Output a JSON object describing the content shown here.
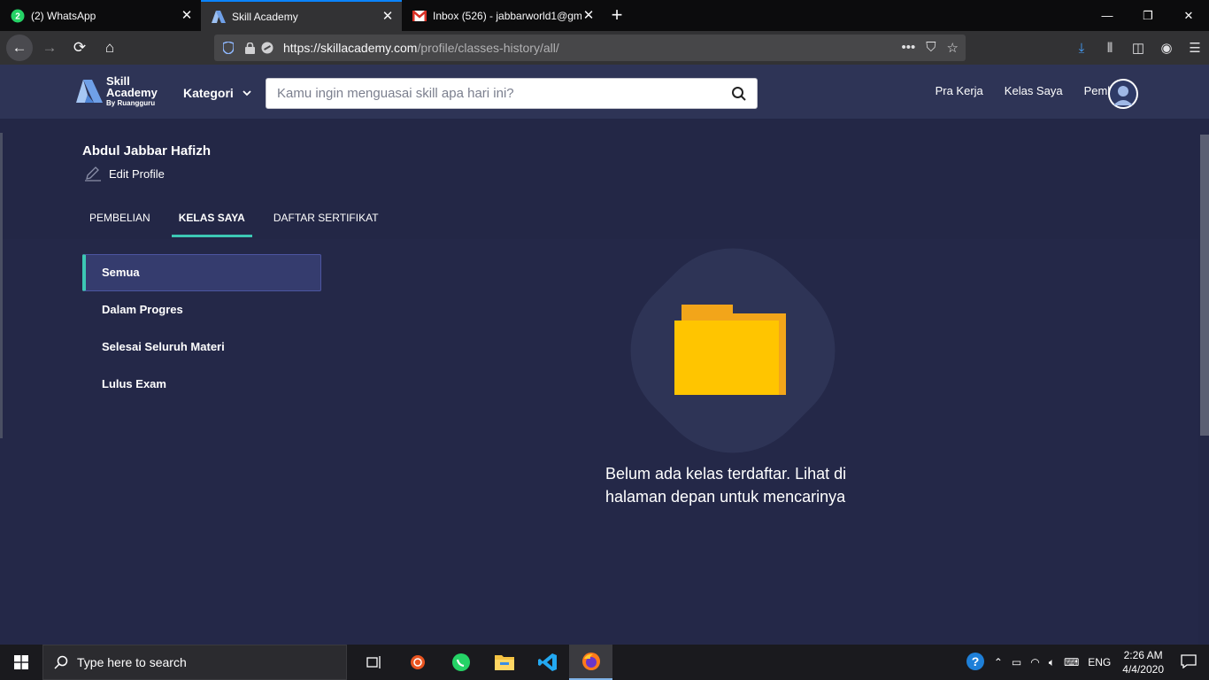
{
  "browser": {
    "tabs": [
      {
        "title": "(2) WhatsApp",
        "icon": "whatsapp-icon",
        "active": false
      },
      {
        "title": "Skill Academy",
        "icon": "skill-academy-icon",
        "active": true
      },
      {
        "title": "Inbox (526) - jabbarworld1@gm",
        "icon": "gmail-icon",
        "active": false
      }
    ],
    "url_host": "https://skillacademy.com",
    "url_path": "/profile/classes-history/all/"
  },
  "site": {
    "logo": {
      "line1": "Skill",
      "line2": "Academy",
      "line3": "By Ruangguru"
    },
    "kategori": "Kategori",
    "search_placeholder": "Kamu ingin menguasai skill apa hari ini?",
    "nav": [
      "Pra Kerja",
      "Kelas Saya",
      "Pembelian"
    ],
    "accent": "#3cc8b4"
  },
  "profile": {
    "name": "Abdul Jabbar Hafizh",
    "edit_label": "Edit Profile",
    "tabs": [
      {
        "label": "PEMBELIAN",
        "active": false
      },
      {
        "label": "KELAS SAYA",
        "active": true
      },
      {
        "label": "DAFTAR SERTIFIKAT",
        "active": false
      }
    ]
  },
  "sidebar": {
    "items": [
      {
        "label": "Semua",
        "active": true
      },
      {
        "label": "Dalam Progres",
        "active": false
      },
      {
        "label": "Selesai Seluruh Materi",
        "active": false
      },
      {
        "label": "Lulus Exam",
        "active": false
      }
    ]
  },
  "empty_state": {
    "icon": "folder-icon",
    "line1": "Belum ada kelas terdaftar. Lihat di",
    "line2": "halaman depan untuk mencarinya"
  },
  "taskbar": {
    "search_placeholder": "Type here to search",
    "language": "ENG",
    "time": "2:26 AM",
    "date": "4/4/2020"
  }
}
